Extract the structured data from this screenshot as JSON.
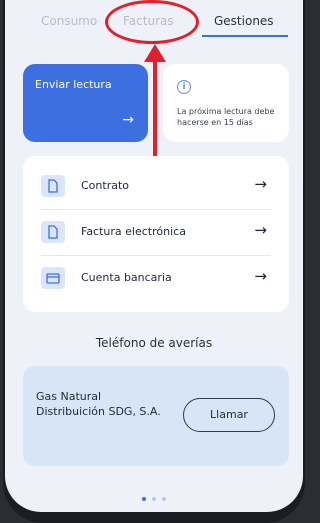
{
  "tabs": [
    {
      "label": "Consumo"
    },
    {
      "label": "Facturas"
    },
    {
      "label": "Gestiones"
    }
  ],
  "active_tab": "Gestiones",
  "send_reading": {
    "label": "Enviar lectura",
    "arrow": "→"
  },
  "info_card": {
    "icon": "info-icon",
    "icon_glyph": "i",
    "text": "La próxima lectura debe hacerse en 15 días"
  },
  "list": [
    {
      "label": "Contrato",
      "icon": "document-icon",
      "arrow": "→"
    },
    {
      "label": "Factura electrónica",
      "icon": "document-icon",
      "arrow": "→"
    },
    {
      "label": "Cuenta bancaria",
      "icon": "card-icon",
      "arrow": "→"
    }
  ],
  "phone_section": {
    "title": "Teléfono de averías",
    "company": "Gas Natural Distribuición SDG, S.A.",
    "call_label": "Llamar"
  },
  "pagination": {
    "pages": 3,
    "current": 1
  },
  "colors": {
    "accent": "#3d6fe0",
    "highlight": "#e2202b",
    "background": "#eef1f8"
  }
}
